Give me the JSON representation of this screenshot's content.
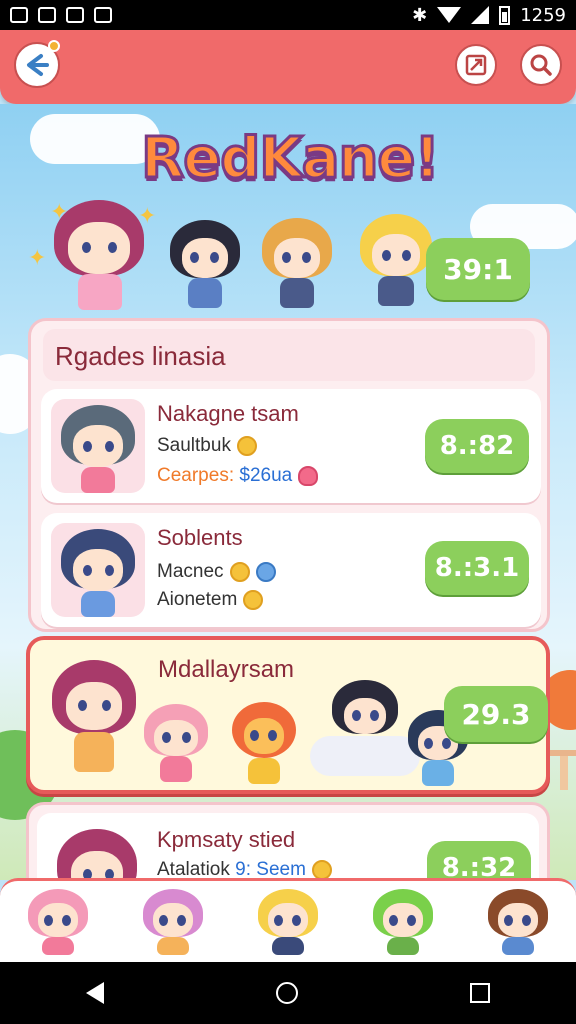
{
  "statusbar": {
    "time": "1259"
  },
  "header": {
    "logo": "RedKane!"
  },
  "top": {
    "score": "39:1"
  },
  "panel": {
    "title": "Rgades linasia",
    "items": [
      {
        "name": "Nakagne tsam",
        "line1": "Saultbuk",
        "line2_label": "Cearpes:",
        "line2_value": "$26ua",
        "score": "8.:82"
      },
      {
        "name": "Soblents",
        "line1": "Macnec",
        "line2_label": "Aionetem",
        "line2_value": "",
        "score": "8.:3.1"
      }
    ]
  },
  "team": {
    "name": "Mdallayrsam",
    "score": "29.3"
  },
  "next": {
    "name": "Kpmsaty stied",
    "line1": "Atalatiok",
    "line1_value": "9: Seem",
    "score": "8.:32"
  },
  "colors": {
    "appbar": "#f06a6a",
    "score_green": "#8ccf5c",
    "panel_pink": "#fdeef0",
    "accent_orange": "#f07a2a"
  },
  "icons": {
    "back": "back-arrow-icon",
    "map": "map-icon",
    "search": "search-icon"
  }
}
